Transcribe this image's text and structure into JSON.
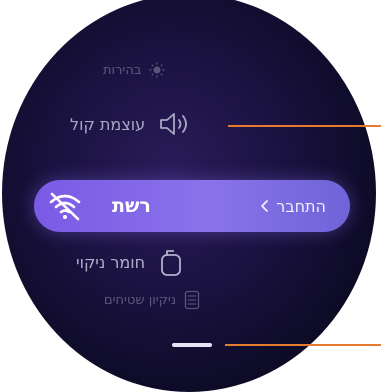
{
  "menu": {
    "brightness_label": "בהירות",
    "volume_label": "עוצמת קול",
    "network_label": "רשת",
    "network_action": "התחבר",
    "detergent_label": "חומר ניקוי",
    "floor_cleaning_label": "ניקיון שטיחים"
  },
  "icons": {
    "brightness": "sun-icon",
    "volume": "speaker-icon",
    "network": "wifi-off-icon",
    "chevron": "chevron-left-icon",
    "detergent": "detergent-bottle-icon",
    "floor": "carpet-icon"
  },
  "colors": {
    "highlight": "#7a5ae6",
    "background": "#0c0a24",
    "callout": "#e67a2e"
  }
}
